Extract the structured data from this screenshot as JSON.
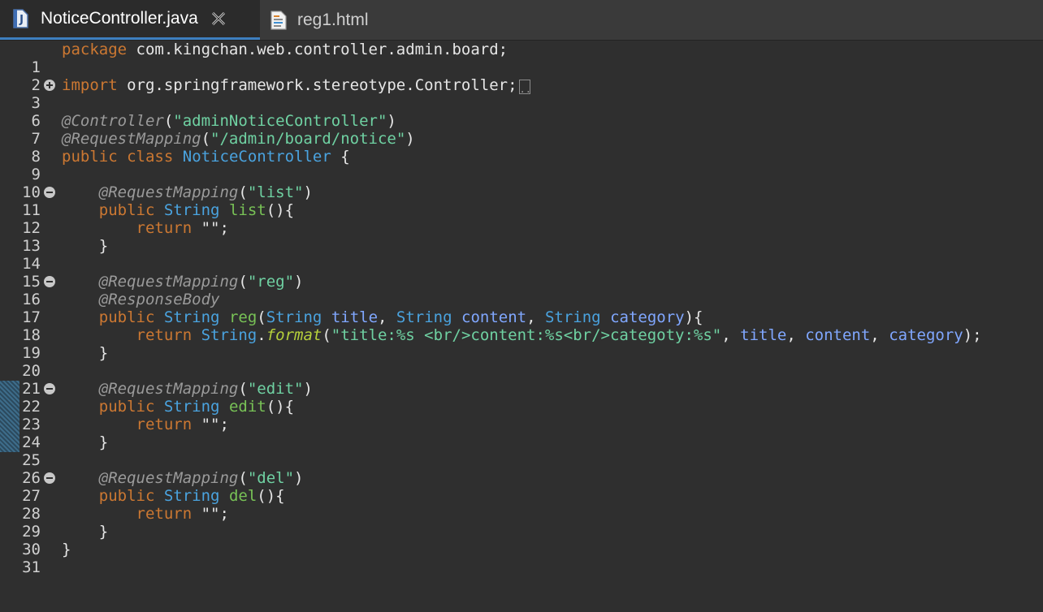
{
  "tabs": [
    {
      "label": "NoticeController.java",
      "active": true,
      "icon": "java-file-icon"
    },
    {
      "label": "reg1.html",
      "active": false,
      "icon": "html-file-icon"
    }
  ],
  "colors": {
    "keyword": "#cc7832",
    "annotation": "#9a9a9a",
    "string": "#6fd1a2",
    "type": "#4aa3df",
    "method": "#78c256",
    "parameter": "#80a7ff",
    "background": "#2f2f2f"
  },
  "editor": {
    "lines": [
      {
        "n": "1"
      },
      {
        "n": "2"
      },
      {
        "n": "3"
      },
      {
        "n": "6"
      },
      {
        "n": "7"
      },
      {
        "n": "8"
      },
      {
        "n": "9"
      },
      {
        "n": "10"
      },
      {
        "n": "11"
      },
      {
        "n": "12"
      },
      {
        "n": "13"
      },
      {
        "n": "14"
      },
      {
        "n": "15"
      },
      {
        "n": "16"
      },
      {
        "n": "17"
      },
      {
        "n": "18"
      },
      {
        "n": "19"
      },
      {
        "n": "20"
      },
      {
        "n": "21"
      },
      {
        "n": "22"
      },
      {
        "n": "23"
      },
      {
        "n": "24"
      },
      {
        "n": "25"
      },
      {
        "n": "26"
      },
      {
        "n": "27"
      },
      {
        "n": "28"
      },
      {
        "n": "29"
      },
      {
        "n": "30"
      },
      {
        "n": "31"
      }
    ],
    "t": {
      "package": "package",
      "package_name": " com.kingchan.web.controller.admin.board;",
      "import": "import",
      "import_name": " org.springframework.stereotype.Controller;",
      "collapsed_marker": "..",
      "ann_controller": "@Controller",
      "paren_open": "(",
      "paren_close": ")",
      "str_admin_notice": "\"adminNoticeController\"",
      "ann_request_mapping": "@RequestMapping",
      "str_path": "\"/admin/board/notice\"",
      "public": "public",
      "class": "class",
      "class_name": "NoticeController",
      "brace_open": " {",
      "indent1": "    ",
      "indent2": "        ",
      "str_list": "\"list\"",
      "type_string": "String",
      "m_list": "list",
      "parens_brace": "(){",
      "return": "return",
      "empty_return": " \"\";",
      "brace_close": "}",
      "str_reg": "\"reg\"",
      "ann_response_body": "@ResponseBody",
      "m_reg": "reg",
      "p_title": "title",
      "p_content": "content",
      "p_category": "category",
      "comma": ", ",
      "close_brace_open": "){",
      "dot": ".",
      "m_format": "format",
      "str_format": "\"title:%s <br/>content:%s<br/>categoty:%s\"",
      "end_call": ");",
      "str_edit": "\"edit\"",
      "m_edit": "edit",
      "str_del": "\"del\"",
      "m_del": "del"
    }
  }
}
